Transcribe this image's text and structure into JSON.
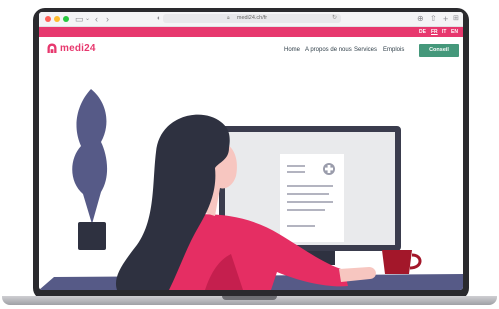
{
  "browser": {
    "url": "medi24.ch/fr",
    "traffic_lights": [
      "#ff5f57",
      "#febc2e",
      "#28c840"
    ],
    "icons": {
      "sidebar": "sidebar-icon",
      "dropdown": "chevron-down-icon",
      "back": "back-icon",
      "forward": "forward-icon",
      "shield": "shield-icon",
      "tab": "tab-icon",
      "lock": "lock-icon",
      "reload": "reload-icon",
      "download": "download-icon",
      "share": "share-icon",
      "new_tab": "plus-icon",
      "tabs_overview": "tabs-overview-icon"
    }
  },
  "languages": [
    {
      "code": "DE",
      "active": false
    },
    {
      "code": "FR",
      "active": true
    },
    {
      "code": "IT",
      "active": false
    },
    {
      "code": "EN",
      "active": false
    }
  ],
  "site": {
    "logo": "medi24",
    "nav": [
      "Home",
      "A propos de nous",
      "Services",
      "Emplois"
    ],
    "cta_label": "Conseil"
  },
  "colors": {
    "brand_pink": "#e7386e",
    "cta_green": "#45987b",
    "nav_text": "#2f3e48",
    "illustration_purple": "#565a87",
    "mug_red": "#a3172a"
  }
}
